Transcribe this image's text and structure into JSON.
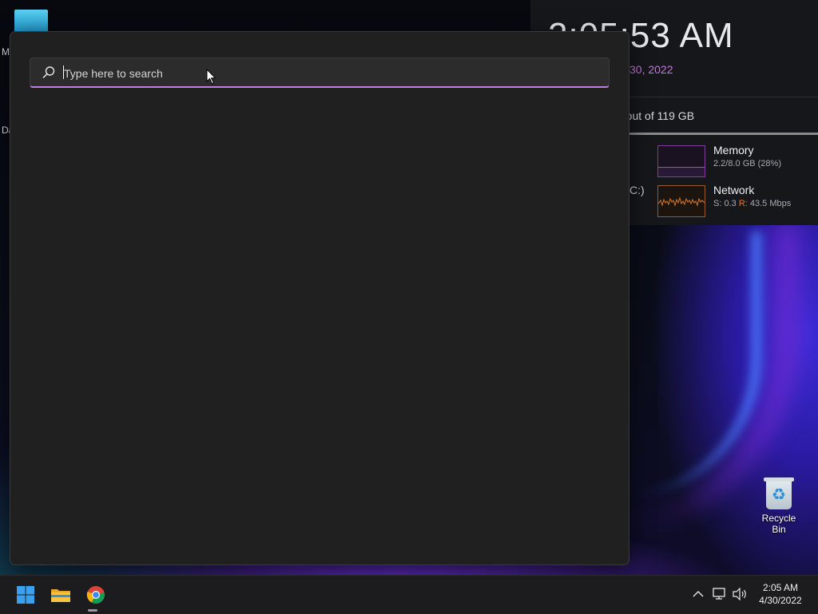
{
  "desktop": {
    "left_icon_letters": [
      "M",
      "Da"
    ],
    "recycle_bin_label": "Recycle Bin"
  },
  "widget": {
    "time": "2:05:53 AM",
    "date": "30, 2022",
    "disk_text": "e out of 119 GB",
    "drive_fragment": "C:)",
    "memory": {
      "title": "Memory",
      "detail": "2.2/8.0 GB (28%)",
      "percent": 28
    },
    "network": {
      "title": "Network",
      "send_label": "S:",
      "send_value": "0.3",
      "recv_label": "R:",
      "recv_value": "43.5 Mbps"
    }
  },
  "search": {
    "placeholder": "Type here to search",
    "value": ""
  },
  "taskbar": {
    "apps": [
      "start-button",
      "file-explorer",
      "chrome"
    ],
    "clock_time": "2:05 AM",
    "clock_date": "4/30/2022"
  },
  "colors": {
    "accent": "#c57ce0",
    "panel_bg": "#202020",
    "taskbar_bg": "#1c1c1f",
    "network_recv": "#e07a2e"
  }
}
